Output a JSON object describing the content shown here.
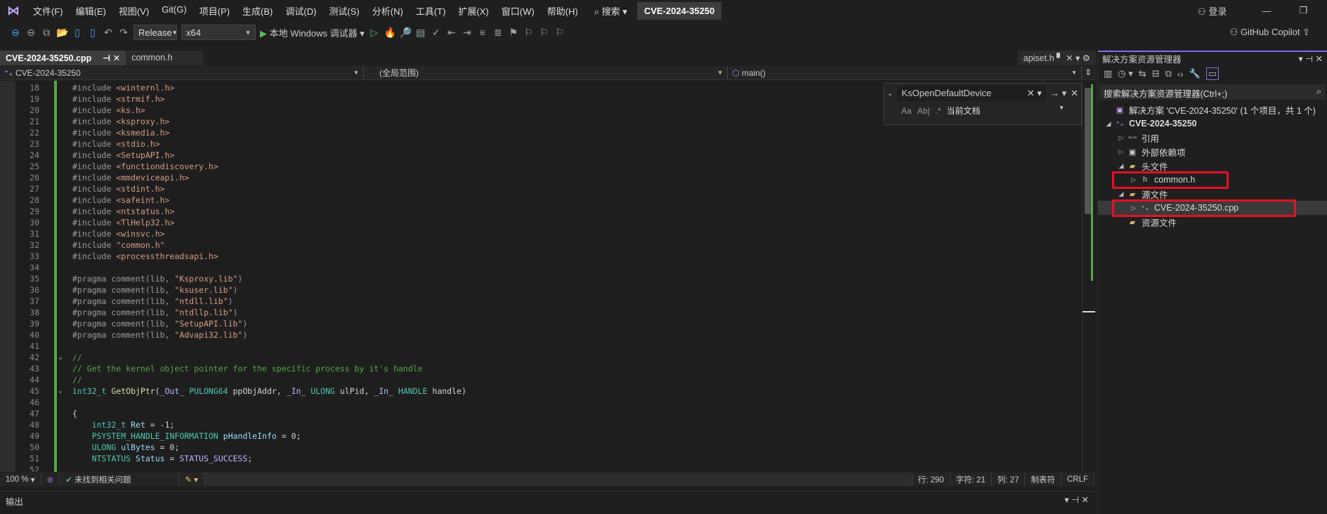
{
  "menubar": {
    "items": [
      "文件(F)",
      "编辑(E)",
      "视图(V)",
      "Git(G)",
      "项目(P)",
      "生成(B)",
      "调试(D)",
      "测试(S)",
      "分析(N)",
      "工具(T)",
      "扩展(X)",
      "窗口(W)",
      "帮助(H)"
    ],
    "search": "搜索",
    "title": "CVE-2024-35250",
    "login": "登录"
  },
  "toolbar": {
    "config": "Release",
    "platform": "x64",
    "run": "本地 Windows 调试器",
    "copilot": "GitHub Copilot"
  },
  "tabs": [
    {
      "label": "CVE-2024-35250.cpp",
      "active": true
    },
    {
      "label": "common.h",
      "active": false
    }
  ],
  "preview_tab": "apiset.h",
  "navbar": {
    "project": "CVE-2024-35250",
    "scope": "(全局范围)",
    "member": "main()"
  },
  "find": {
    "query": "KsOpenDefaultDevice",
    "scope": "当前文档"
  },
  "code_lines": [
    {
      "n": 18,
      "t": [
        [
          "#include ",
          "pp"
        ],
        [
          "<winternl.h>",
          "str"
        ]
      ]
    },
    {
      "n": 19,
      "t": [
        [
          "#include ",
          "pp"
        ],
        [
          "<strmif.h>",
          "str"
        ]
      ]
    },
    {
      "n": 20,
      "t": [
        [
          "#include ",
          "pp"
        ],
        [
          "<ks.h>",
          "str"
        ]
      ]
    },
    {
      "n": 21,
      "t": [
        [
          "#include ",
          "pp"
        ],
        [
          "<ksproxy.h>",
          "str"
        ]
      ]
    },
    {
      "n": 22,
      "t": [
        [
          "#include ",
          "pp"
        ],
        [
          "<ksmedia.h>",
          "str"
        ]
      ]
    },
    {
      "n": 23,
      "t": [
        [
          "#include ",
          "pp"
        ],
        [
          "<stdio.h>",
          "str"
        ]
      ]
    },
    {
      "n": 24,
      "t": [
        [
          "#include ",
          "pp"
        ],
        [
          "<SetupAPI.h>",
          "str"
        ]
      ]
    },
    {
      "n": 25,
      "t": [
        [
          "#include ",
          "pp"
        ],
        [
          "<functiondiscovery.h>",
          "str"
        ]
      ]
    },
    {
      "n": 26,
      "t": [
        [
          "#include ",
          "pp"
        ],
        [
          "<mmdeviceapi.h>",
          "str"
        ]
      ]
    },
    {
      "n": 27,
      "t": [
        [
          "#include ",
          "pp"
        ],
        [
          "<stdint.h>",
          "str"
        ]
      ]
    },
    {
      "n": 28,
      "t": [
        [
          "#include ",
          "pp"
        ],
        [
          "<safeint.h>",
          "str"
        ]
      ]
    },
    {
      "n": 29,
      "t": [
        [
          "#include ",
          "pp"
        ],
        [
          "<ntstatus.h>",
          "str"
        ]
      ]
    },
    {
      "n": 30,
      "t": [
        [
          "#include ",
          "pp"
        ],
        [
          "<TlHelp32.h>",
          "str"
        ]
      ]
    },
    {
      "n": 31,
      "t": [
        [
          "#include ",
          "pp"
        ],
        [
          "<winsvc.h>",
          "str"
        ]
      ]
    },
    {
      "n": 32,
      "t": [
        [
          "#include ",
          "pp"
        ],
        [
          "\"common.h\"",
          "str"
        ]
      ]
    },
    {
      "n": 33,
      "t": [
        [
          "#include ",
          "pp"
        ],
        [
          "<processthreadsapi.h>",
          "str"
        ]
      ]
    },
    {
      "n": 34,
      "t": []
    },
    {
      "n": 35,
      "t": [
        [
          "#pragma comment(lib, ",
          "pp"
        ],
        [
          "\"Ksproxy.lib\"",
          "str"
        ],
        [
          ")",
          "pp"
        ]
      ]
    },
    {
      "n": 36,
      "t": [
        [
          "#pragma comment(lib, ",
          "pp"
        ],
        [
          "\"ksuser.lib\"",
          "str"
        ],
        [
          ")",
          "pp"
        ]
      ]
    },
    {
      "n": 37,
      "t": [
        [
          "#pragma comment(lib, ",
          "pp"
        ],
        [
          "\"ntdll.lib\"",
          "str"
        ],
        [
          ")",
          "pp"
        ]
      ]
    },
    {
      "n": 38,
      "t": [
        [
          "#pragma comment(lib, ",
          "pp"
        ],
        [
          "\"ntdllp.lib\"",
          "str"
        ],
        [
          ")",
          "pp"
        ]
      ]
    },
    {
      "n": 39,
      "t": [
        [
          "#pragma comment(lib, ",
          "pp"
        ],
        [
          "\"SetupAPI.lib\"",
          "str"
        ],
        [
          ")",
          "pp"
        ]
      ]
    },
    {
      "n": 40,
      "t": [
        [
          "#pragma comment(lib, ",
          "pp"
        ],
        [
          "\"Advapi32.lib\"",
          "str"
        ],
        [
          ")",
          "pp"
        ]
      ]
    },
    {
      "n": 41,
      "t": []
    },
    {
      "n": 42,
      "fold": true,
      "t": [
        [
          "//",
          "cm"
        ]
      ]
    },
    {
      "n": 43,
      "t": [
        [
          "// Get the kernel object pointer for the specific process by it's handle",
          "cm"
        ]
      ]
    },
    {
      "n": 44,
      "t": [
        [
          "//",
          "cm"
        ]
      ]
    },
    {
      "n": 45,
      "fold": true,
      "t": [
        [
          "int32_t ",
          "ty"
        ],
        [
          "GetObjPtr",
          "fn"
        ],
        [
          "(",
          "pl"
        ],
        [
          "_Out_ ",
          "mac"
        ],
        [
          "PULONG64 ",
          "ty"
        ],
        [
          "ppObjAddr, ",
          "pl"
        ],
        [
          "_In_ ",
          "mac"
        ],
        [
          "ULONG ",
          "ty"
        ],
        [
          "ulPid, ",
          "pl"
        ],
        [
          "_In_ ",
          "mac"
        ],
        [
          "HANDLE ",
          "ty"
        ],
        [
          "handle)",
          "pl"
        ]
      ]
    },
    {
      "n": 46,
      "t": []
    },
    {
      "n": 47,
      "t": [
        [
          "{",
          "pl"
        ]
      ]
    },
    {
      "n": 48,
      "t": [
        [
          "    int32_t ",
          "ty"
        ],
        [
          "Ret",
          "var"
        ],
        [
          " = -1;",
          "pl"
        ]
      ]
    },
    {
      "n": 49,
      "t": [
        [
          "    PSYSTEM_HANDLE_INFORMATION ",
          "ty"
        ],
        [
          "pHandleInfo",
          "var"
        ],
        [
          " = 0;",
          "pl"
        ]
      ]
    },
    {
      "n": 50,
      "t": [
        [
          "    ULONG ",
          "ty"
        ],
        [
          "ulBytes",
          "var"
        ],
        [
          " = 0;",
          "pl"
        ]
      ]
    },
    {
      "n": 51,
      "t": [
        [
          "    NTSTATUS ",
          "ty"
        ],
        [
          "Status",
          "var"
        ],
        [
          " = ",
          "pl"
        ],
        [
          "STATUS_SUCCESS",
          "mac"
        ],
        [
          ";",
          "pl"
        ]
      ]
    },
    {
      "n": 52,
      "t": []
    }
  ],
  "status": {
    "zoom": "100 %",
    "issues": "未找到相关问题",
    "line": "行: 290",
    "char": "字符: 21",
    "col": "列: 27",
    "indent": "制表符",
    "eol": "CRLF"
  },
  "output": {
    "title": "输出"
  },
  "solution": {
    "title": "解决方案资源管理器",
    "search": "搜索解决方案资源管理器(Ctrl+;)",
    "tree": [
      {
        "label": "解决方案 'CVE-2024-35250' (1 个项目，共 1 个)",
        "depth": 0,
        "arrow": "",
        "icon": "solution-icon",
        "glyph": "▣"
      },
      {
        "label": "CVE-2024-35250",
        "depth": 0,
        "arrow": "◢",
        "icon": "project-icon",
        "glyph": "⁺₊",
        "bold": true
      },
      {
        "label": "引用",
        "depth": 1,
        "arrow": "▷",
        "icon": "references-icon",
        "glyph": "▫-▫"
      },
      {
        "label": "外部依赖项",
        "depth": 1,
        "arrow": "▷",
        "icon": "external-deps-icon",
        "glyph": "▣"
      },
      {
        "label": "头文件",
        "depth": 1,
        "arrow": "◢",
        "icon": "folder-filter-icon",
        "glyph": "▰"
      },
      {
        "label": "common.h",
        "depth": 2,
        "arrow": "▷",
        "icon": "header-file-icon",
        "glyph": "h",
        "highlight": true
      },
      {
        "label": "源文件",
        "depth": 1,
        "arrow": "◢",
        "icon": "folder-filter-icon",
        "glyph": "▰"
      },
      {
        "label": "CVE-2024-35250.cpp",
        "depth": 2,
        "arrow": "▷",
        "icon": "cpp-file-icon",
        "glyph": "⁺₊",
        "highlight": true,
        "selected": true
      },
      {
        "label": "资源文件",
        "depth": 1,
        "arrow": "",
        "icon": "folder-filter-icon",
        "glyph": "▰"
      }
    ]
  },
  "colors": {
    "accent": "#7f6fe8",
    "highlight_box": "#e81123",
    "change_bar": "#57a64a"
  }
}
